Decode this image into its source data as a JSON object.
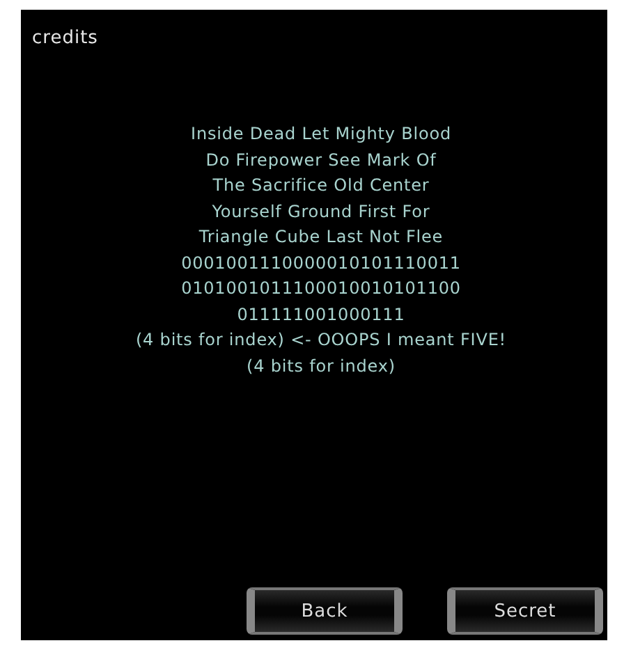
{
  "title": "credits",
  "lines": [
    "Inside Dead Let Mighty Blood",
    "Do Firepower See Mark Of",
    "The Sacrifice Old Center",
    "Yourself Ground First For",
    "Triangle Cube Last Not Flee",
    "0001001110000010101110011",
    "0101001011100010010101100",
    "011111001000111",
    "(4 bits for index) <- OOOPS I meant FIVE!",
    "(4 bits for index)"
  ],
  "buttons": [
    "Back",
    "Secret"
  ]
}
